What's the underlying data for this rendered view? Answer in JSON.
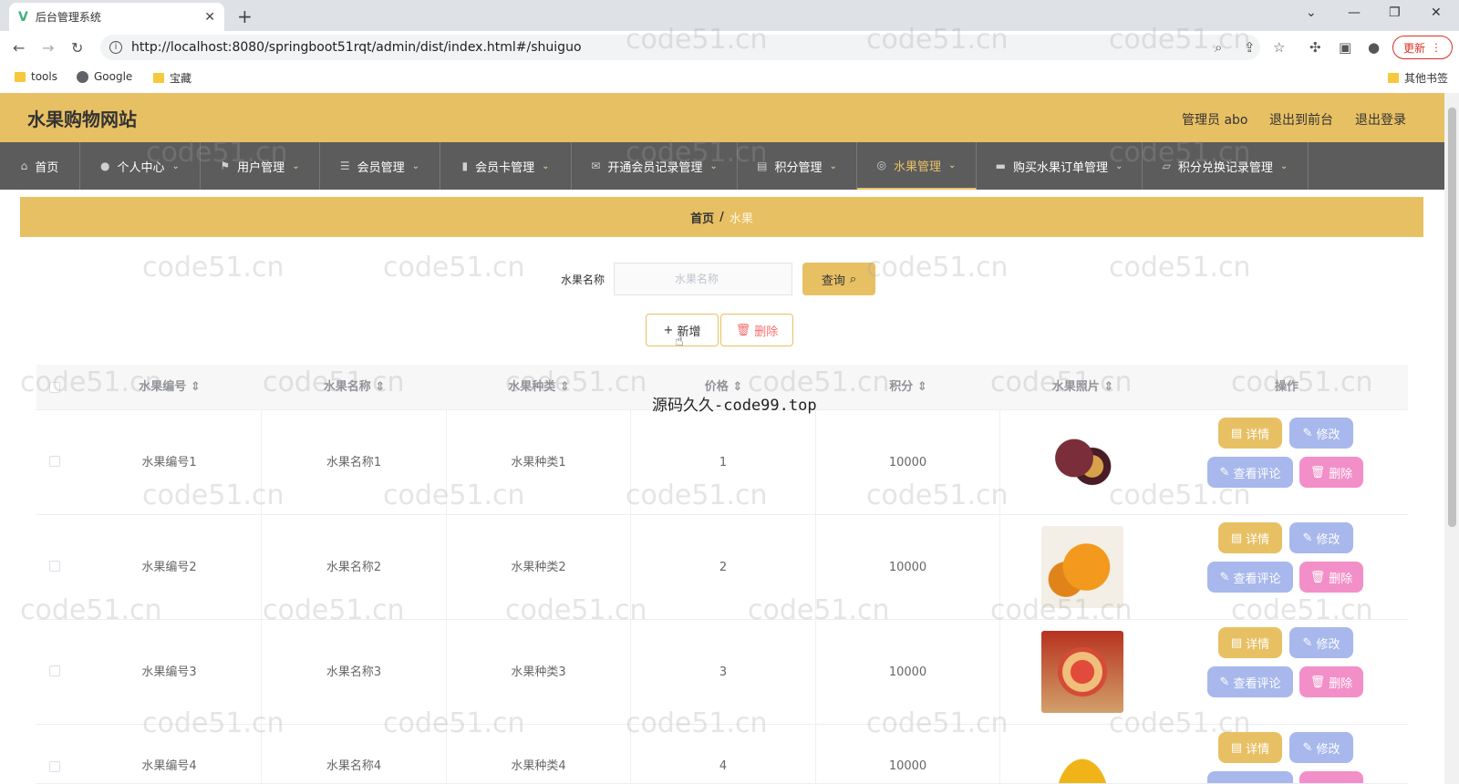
{
  "browser": {
    "tab_title": "后台管理系统",
    "url": "http://localhost:8080/springboot51rqt/admin/dist/index.html#/shuiguo",
    "update_label": "更新",
    "bookmarks": [
      "tools",
      "Google",
      "宝藏"
    ],
    "other_bookmarks": "其他书签"
  },
  "header": {
    "site_title": "水果购物网站",
    "admin_label": "管理员 abo",
    "back_front": "退出到前台",
    "logout": "退出登录"
  },
  "menu": [
    {
      "label": "首页",
      "icon": "home-icon"
    },
    {
      "label": "个人中心",
      "icon": "user-icon"
    },
    {
      "label": "用户管理",
      "icon": "flag-icon"
    },
    {
      "label": "会员管理",
      "icon": "list-icon"
    },
    {
      "label": "会员卡管理",
      "icon": "bar-chart-icon"
    },
    {
      "label": "开通会员记录管理",
      "icon": "mail-icon"
    },
    {
      "label": "积分管理",
      "icon": "clipboard-icon"
    },
    {
      "label": "水果管理",
      "icon": "circle-icon"
    },
    {
      "label": "购买水果订单管理",
      "icon": "chat-icon"
    },
    {
      "label": "积分兑换记录管理",
      "icon": "chart-icon"
    }
  ],
  "breadcrumb": {
    "home": "首页",
    "sep": "/",
    "current": "水果"
  },
  "search": {
    "label": "水果名称",
    "placeholder": "水果名称",
    "query_label": "查询"
  },
  "actions": {
    "add_label": "新增",
    "delete_label": "删除"
  },
  "table": {
    "headers": [
      "水果编号",
      "水果名称",
      "水果种类",
      "价格",
      "积分",
      "水果照片",
      "操作"
    ],
    "rows": [
      {
        "code": "水果编号1",
        "name": "水果名称1",
        "kind": "水果种类1",
        "price": "1",
        "points": "10000"
      },
      {
        "code": "水果编号2",
        "name": "水果名称2",
        "kind": "水果种类2",
        "price": "2",
        "points": "10000"
      },
      {
        "code": "水果编号3",
        "name": "水果名称3",
        "kind": "水果种类3",
        "price": "3",
        "points": "10000"
      },
      {
        "code": "水果编号4",
        "name": "水果名称4",
        "kind": "水果种类4",
        "price": "4",
        "points": "10000"
      }
    ],
    "row_actions": {
      "detail": "详情",
      "edit": "修改",
      "review": "查看评论",
      "remove": "删除"
    }
  },
  "watermark": {
    "text": "code51.cn",
    "center_text": "源码久久-code99.top"
  },
  "colors": {
    "accent": "#e8c064",
    "menu_bg": "#5c5c5c",
    "edit": "#a8b8ec",
    "remove": "#f28fc8"
  }
}
